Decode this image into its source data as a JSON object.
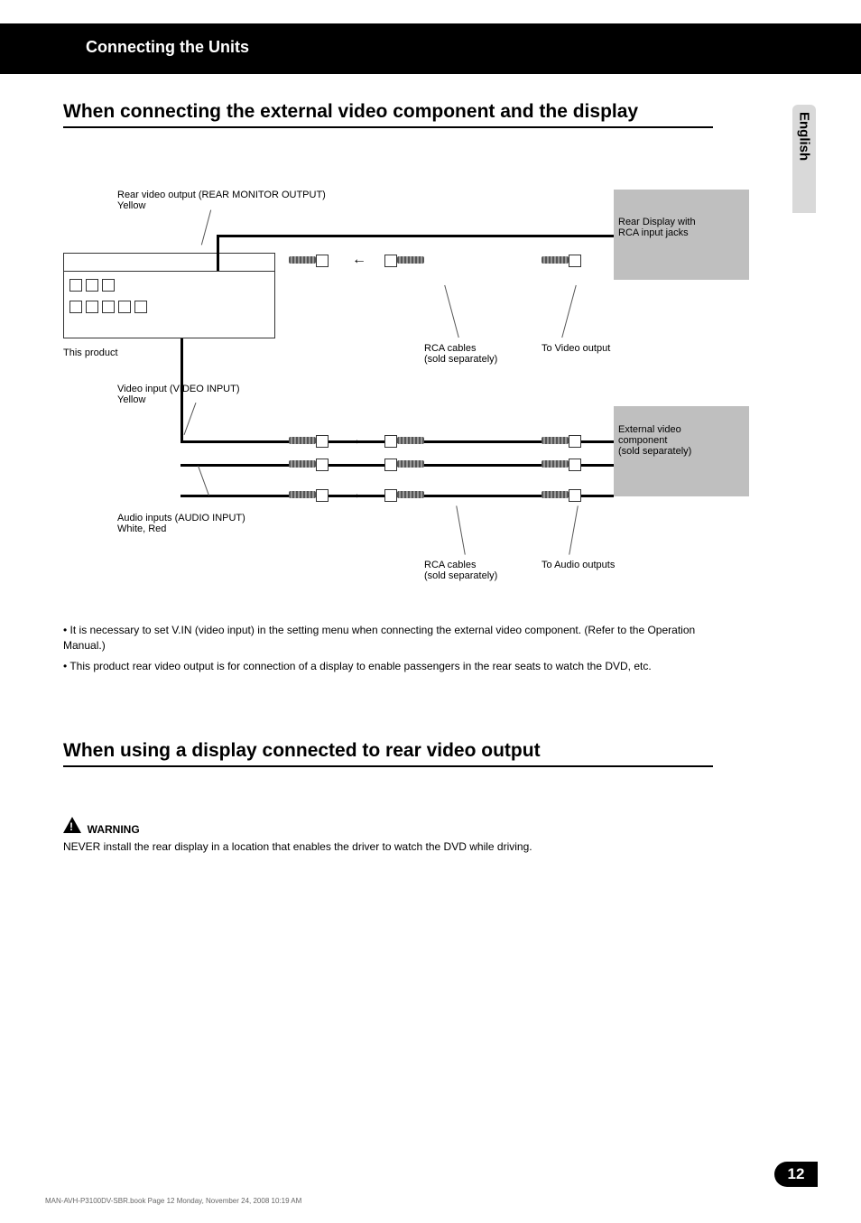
{
  "header": {
    "section_label": "Connecting the Units"
  },
  "language_tab": {
    "label": "English"
  },
  "section1": {
    "heading": "When connecting the external video component and the display"
  },
  "diagram": {
    "callouts": {
      "rear_video_output": "Rear video output (REAR MONITOR OUTPUT)\nYellow",
      "unit_label": "This product",
      "video_input": "Video input (VIDEO INPUT)\nYellow",
      "audio_inputs": "Audio inputs (AUDIO INPUT)\nWhite, Red",
      "rear_display": "Rear Display with\nRCA input jacks",
      "rca_cables_sold_sep": "RCA cables\n(sold separately)",
      "ext_component": "External video\ncomponent\n(sold separately)",
      "to_video_output": "To Video output",
      "to_audio_outputs": "To Audio outputs"
    }
  },
  "notes": {
    "note1": "It is necessary to set V.IN (video input) in the setting menu when connecting the external video component. (Refer to the Operation Manual.)",
    "note2": "This product rear video output is for connection of a display to enable passengers in the rear seats to watch the DVD, etc."
  },
  "section2": {
    "heading": "When using a display connected to rear video output"
  },
  "warning": {
    "title": "WARNING",
    "body": "NEVER install the rear display in a location that enables the driver to watch the DVD while driving."
  },
  "footer": {
    "page_number": "12",
    "pub_code": "MAN-AVH-P3100DV-SBR.book  Page 12  Monday, November 24, 2008  10:19 AM"
  }
}
